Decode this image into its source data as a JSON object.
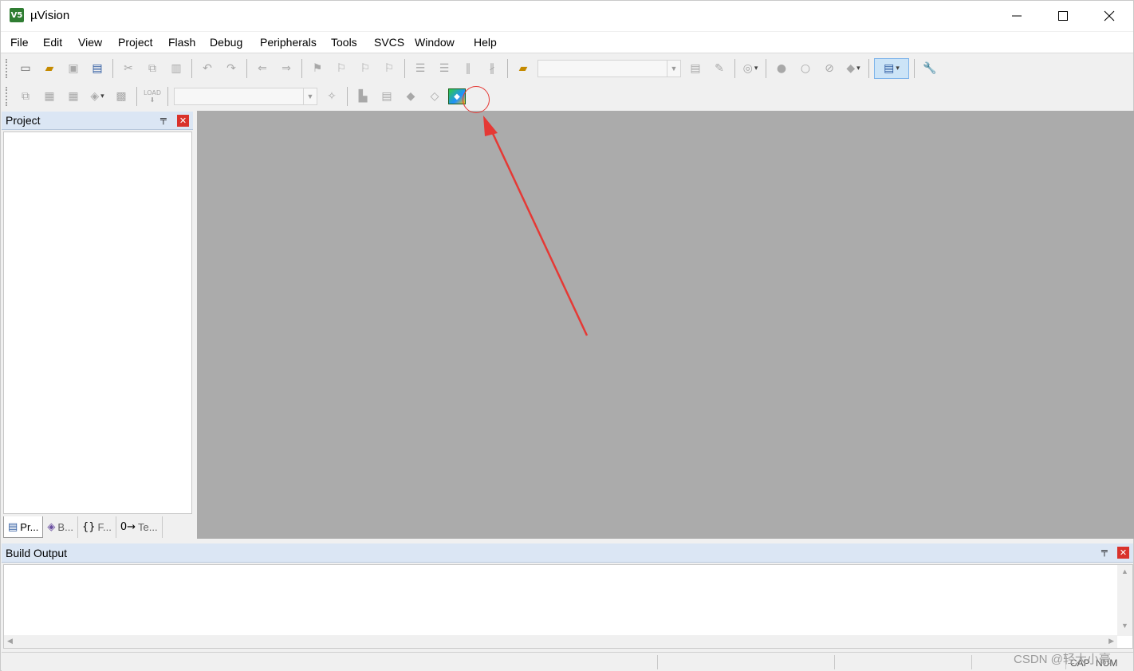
{
  "window": {
    "title": "µVision",
    "logo_text": "V5"
  },
  "menu": [
    {
      "label": "File"
    },
    {
      "label": "Edit"
    },
    {
      "label": "View"
    },
    {
      "label": "Project"
    },
    {
      "label": "Flash"
    },
    {
      "label": "Debug"
    },
    {
      "label": "Peripherals"
    },
    {
      "label": "Tools"
    },
    {
      "label": "SVCS"
    },
    {
      "label": "Window"
    },
    {
      "label": "Help"
    }
  ],
  "toolbar2": {
    "load_label": "LOAD"
  },
  "project_pane": {
    "title": "Project",
    "close_glyph": "✕",
    "tabs": [
      {
        "label": "Pr..."
      },
      {
        "label": "B..."
      },
      {
        "label": "F..."
      },
      {
        "label": "Te..."
      }
    ]
  },
  "build_output": {
    "title": "Build Output",
    "close_glyph": "✕"
  },
  "status": {
    "caps": "CAP",
    "num": "NUM"
  },
  "watermark": "CSDN @轻大小豪",
  "colors": {
    "title_bg": "#ffffff",
    "pane_header_bg": "#dbe6f4",
    "editor_bg": "#ababab",
    "close_red": "#d9322b",
    "annotation_red": "#e53935"
  },
  "icons": {
    "target_button": "manage-run-time-environment-icon"
  }
}
